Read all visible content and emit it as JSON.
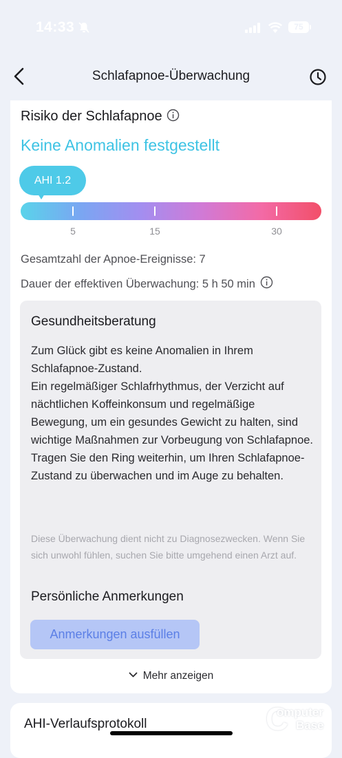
{
  "status_bar": {
    "time": "14:33",
    "battery": "75",
    "icons": [
      "bell-muted-icon",
      "signal-icon",
      "wifi-icon",
      "battery-icon"
    ]
  },
  "header": {
    "title": "Schlafapnoe-Überwachung",
    "back_icon": "chevron-left-icon",
    "history_icon": "clock-icon"
  },
  "risk": {
    "title": "Risiko der Schlafapnoe",
    "status": "Keine Anomalien festgestellt",
    "ahi_label": "AHI 1.2",
    "ahi_value": 1.2,
    "scale_labels": [
      "5",
      "15",
      "30"
    ]
  },
  "stats": {
    "total_events": "Gesamtzahl der Apnoe-Ereignisse: 7",
    "duration": "Dauer der effektiven Überwachung: 5 h 50 min"
  },
  "advice": {
    "title": "Gesundheitsberatung",
    "text": "Zum Glück gibt es keine Anomalien in Ihrem Schlafapnoe-Zustand.\nEin regelmäßiger Schlafrhythmus, der Verzicht auf nächtlichen Koffeinkonsum und regelmäßige Bewegung, um ein gesundes Gewicht zu halten, sind wichtige Maßnahmen zur Vorbeugung von Schlafapnoe. Tragen Sie den Ring weiterhin, um Ihren Schlafapnoe-Zustand zu überwachen und im Auge zu behalten.",
    "disclaimer": "Diese Überwachung dient nicht zu Diagnosezwecken. Wenn Sie sich unwohl fühlen, suchen Sie bitte umgehend einen Arzt auf."
  },
  "notes": {
    "title": "Persönliche Anmerkungen",
    "button_label": "Anmerkungen ausfüllen"
  },
  "more": {
    "label": "Mehr anzeigen"
  },
  "history": {
    "title": "AHI-Verlaufsprotokoll"
  },
  "watermark": {
    "line1": "omputer",
    "line2": "Base"
  },
  "colors": {
    "accent": "#3ec3e4",
    "bubble": "#4ecae8",
    "button_bg": "#b5c6f6",
    "button_text": "#5b7fe6",
    "background": "#eef1f8"
  }
}
